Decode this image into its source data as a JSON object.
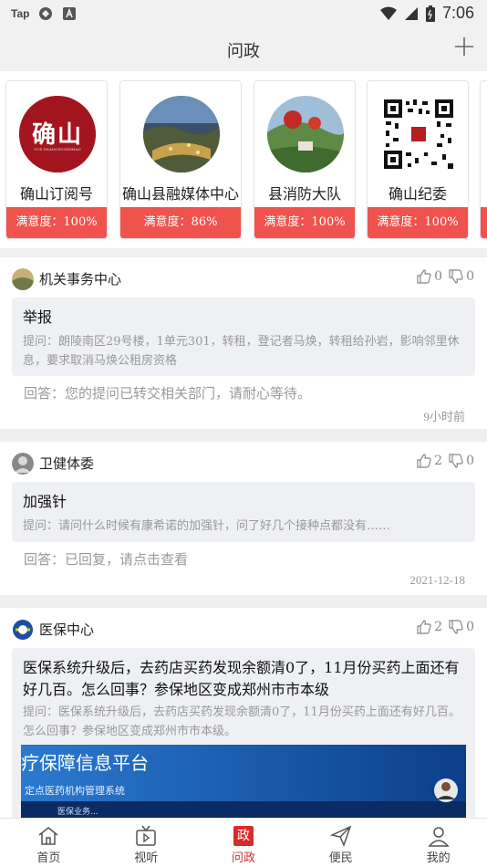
{
  "status": {
    "carrier": "Tap",
    "time": "7:06"
  },
  "header": {
    "title": "问政"
  },
  "accounts": [
    {
      "name": "确山订阅号",
      "satisfaction": "满意度：100%",
      "avatar_text": "确山",
      "avatar_sub": "YUE SHANGXIUZHIHAN"
    },
    {
      "name": "确山县融媒体中心",
      "satisfaction": "满意度：86%"
    },
    {
      "name": "县消防大队",
      "satisfaction": "满意度：100%"
    },
    {
      "name": "确山纪委",
      "satisfaction": "满意度：100%"
    }
  ],
  "posts": [
    {
      "dept": "机关事务中心",
      "likes": "0",
      "dislikes": "0",
      "title": "举报",
      "question": "提问：朗陵南区29号楼，1单元301，转租，登记者马焕，转租给孙岩，影响邻里休息，要求取消马焕公租房资格",
      "answer": "回答：您的提问已转交相关部门，请耐心等待。",
      "time": "9小时前"
    },
    {
      "dept": "卫健体委",
      "likes": "2",
      "dislikes": "0",
      "title": "加强针",
      "question": "提问：请问什么时候有康希诺的加强针，问了好几个接种点都没有……",
      "answer": "回答：已回复，请点击查看",
      "time": "2021-12-18"
    },
    {
      "dept": "医保中心",
      "likes": "2",
      "dislikes": "0",
      "title": "医保系统升级后，去药店买药发现余额清0了，11月份买药上面还有好几百。怎么回事？参保地区变成郑州市市本级",
      "question": "提问：医保系统升级后，去药店买药发现余额清0了，11月份买药上面还有好几百。怎么回事？参保地区变成郑州市市本级。",
      "image_text_1": "疗保障信息平台",
      "image_text_2": "定点医药机构管理系统",
      "image_text_3": "医保业务..."
    }
  ],
  "tabs": [
    {
      "label": "首页",
      "icon": "home-icon"
    },
    {
      "label": "视听",
      "icon": "tv-icon"
    },
    {
      "label": "问政",
      "icon": "gov-icon",
      "badge": "政"
    },
    {
      "label": "便民",
      "icon": "paper-plane-icon"
    },
    {
      "label": "我的",
      "icon": "user-icon"
    }
  ],
  "colors": {
    "accent": "#f0524d",
    "active_tab": "#d92b28"
  }
}
